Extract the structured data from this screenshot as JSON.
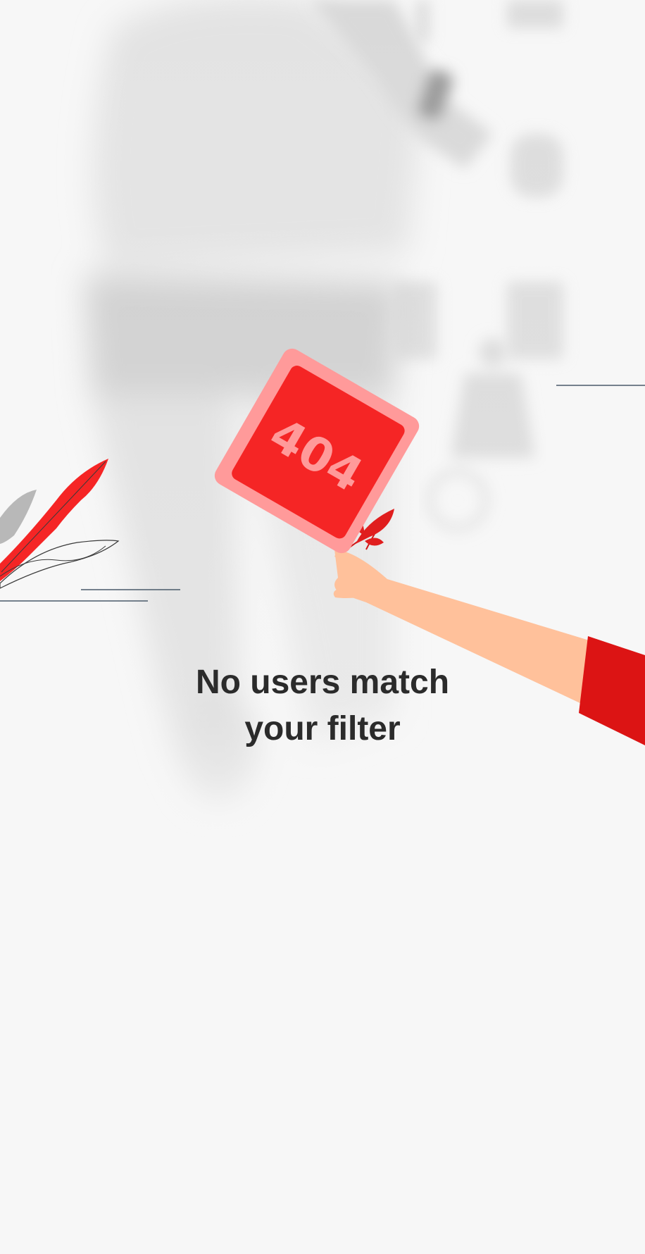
{
  "empty_state": {
    "sign_text": "404",
    "message_line1": "No users match",
    "message_line2": "your filter"
  },
  "colors": {
    "background": "#f7f7f7",
    "accent_red": "#f52525",
    "sign_outer": "#ff9a9a",
    "skin": "#ffc19b",
    "sleeve": "#dc1414",
    "text": "#2b2b2b"
  },
  "icons": {
    "sign": "404-sign-illustration",
    "hand": "hand-illustration",
    "plant": "plant-leaves-illustration"
  }
}
